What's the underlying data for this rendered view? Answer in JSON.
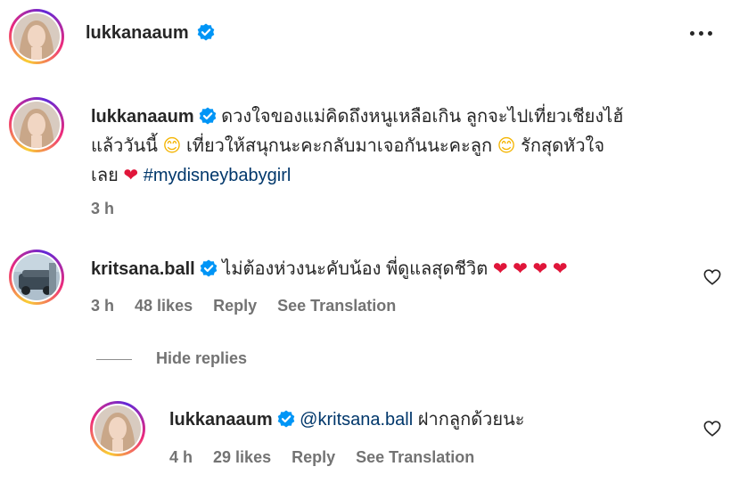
{
  "post": {
    "username": "lukkanaaum",
    "more_icon": "more-horizontal-icon"
  },
  "caption": {
    "username": "lukkanaaum",
    "line1": "ดวงใจของแม่คิดถึงหนูเหลือเกิน ลูกจะไปเที่ยวเชียงไฮ้",
    "line2a": "แล้ววันนี้",
    "line2b": "เที่ยวให้สนุกนะคะกลับมาเจอกันนะคะลูก",
    "line2c": "รักสุดหัวใจ",
    "line3a": "เลย",
    "hashtag": "#mydisneybabygirl",
    "time": "3 h",
    "emoji_smile": "😊",
    "emoji_heart": "❤"
  },
  "comment1": {
    "username": "kritsana.ball",
    "text": "ไม่ต้องห่วงนะคับน้อง พี่ดูแลสุดชีวิต",
    "hearts": [
      "❤",
      "❤",
      "❤",
      "❤"
    ],
    "time": "3 h",
    "likes": "48 likes",
    "reply": "Reply",
    "translate": "See Translation"
  },
  "replies_toggle": "Hide replies",
  "reply1": {
    "username": "lukkanaaum",
    "mention": "@kritsana.ball",
    "text": "ฝากลูกด้วยนะ",
    "time": "4 h",
    "likes": "29 likes",
    "reply": "Reply",
    "translate": "See Translation"
  },
  "colors": {
    "text": "#262626",
    "meta": "#737373",
    "link": "#00376b",
    "verified": "#0095f6",
    "heart": "#e0163a"
  }
}
